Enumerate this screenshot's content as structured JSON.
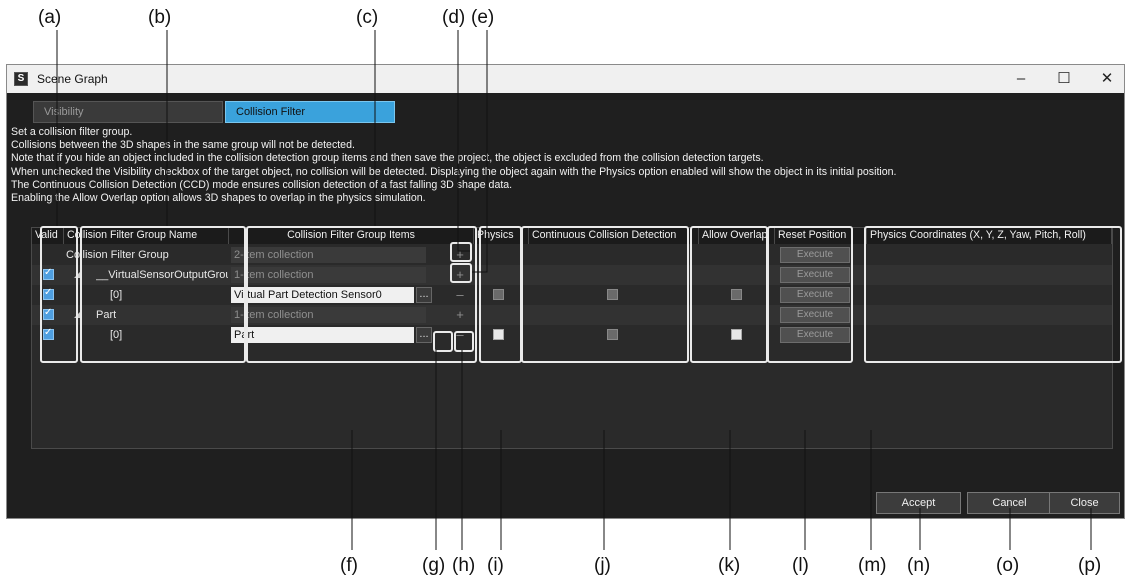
{
  "callouts": {
    "a": "(a)",
    "b": "(b)",
    "c": "(c)",
    "d": "(d)",
    "e": "(e)",
    "f": "(f)",
    "g": "(g)",
    "h": "(h)",
    "i": "(i)",
    "j": "(j)",
    "k": "(k)",
    "l": "(l)",
    "m": "(m)",
    "n": "(n)",
    "o": "(o)",
    "p": "(p)"
  },
  "window": {
    "title": "Scene Graph",
    "minimize": "–",
    "maximize": "☐",
    "close": "✕"
  },
  "tabs": [
    {
      "label": "Visibility"
    },
    {
      "label": "Collision Filter"
    }
  ],
  "info_lines": [
    "Set a collision filter group.",
    "Collisions between the 3D shapes in the same group will not be detected.",
    "Note that if you hide an object included in the collision detection group items and then save the project, the object is excluded from the collision detection targets.",
    "When unchecked the Visibility checkbox of the target object, no collision will be detected. Displaying the object again with the Physics option enabled will show the object in its initial position.",
    "The Continuous Collision Detection (CCD) mode ensures collision detection of a fast falling 3D shape data.",
    "Enabling the Allow Overlap option allows 3D shapes to overlap in the physics simulation."
  ],
  "columns": {
    "valid": "Valid",
    "group_name": "Collision Filter Group Name",
    "group_items": "Collision Filter Group Items",
    "physics": "Physics",
    "ccd": "Continuous Collision Detection",
    "allow_overlap": "Allow Overlap",
    "reset_position": "Reset Position",
    "physics_coords": "Physics Coordinates (X, Y, Z, Yaw, Pitch, Roll)"
  },
  "rows": [
    {
      "name": "Collision Filter Group",
      "items": "2-item collection",
      "execute": "Execute"
    },
    {
      "expander": "◢",
      "name": "__VirtualSensorOutputGroup",
      "items": "1-item collection",
      "execute": "Execute"
    },
    {
      "name": "[0]",
      "items": "Virtual Part Detection Sensor0",
      "ellipsis": "...",
      "execute": "Execute"
    },
    {
      "expander": "◢",
      "name": "Part",
      "items": "1-item collection",
      "execute": "Execute"
    },
    {
      "name": "[0]",
      "items": "Part",
      "ellipsis": "...",
      "execute": "Execute"
    }
  ],
  "plus": "+",
  "minus": "–",
  "footer": {
    "accept": "Accept",
    "cancel": "Cancel",
    "close": "Close"
  },
  "colors": {
    "accent_tab": "#3aa2dc",
    "checkbox": "#4f9fe0",
    "background": "#1f1f1f"
  }
}
